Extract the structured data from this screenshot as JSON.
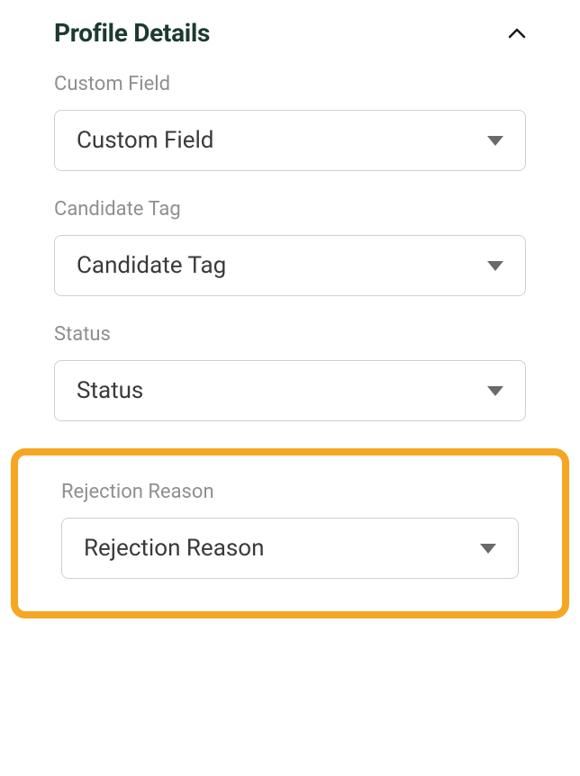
{
  "section": {
    "title": "Profile Details"
  },
  "fields": {
    "customField": {
      "label": "Custom Field",
      "value": "Custom Field"
    },
    "candidateTag": {
      "label": "Candidate Tag",
      "value": "Candidate Tag"
    },
    "status": {
      "label": "Status",
      "value": "Status"
    },
    "rejectionReason": {
      "label": "Rejection Reason",
      "value": "Rejection Reason"
    }
  }
}
